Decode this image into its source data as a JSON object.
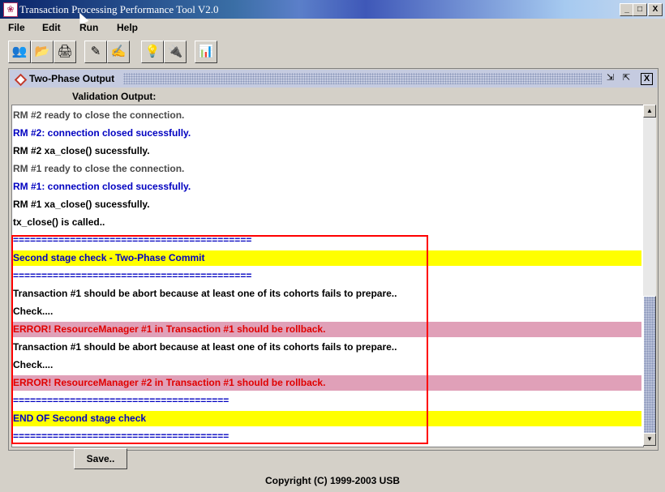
{
  "window": {
    "title": "Transaction Processing Performance Tool V2.0",
    "app_icon": "app-icon",
    "buttons": [
      "_",
      "□",
      "X"
    ]
  },
  "menu": [
    {
      "label": "File"
    },
    {
      "label": "Edit"
    },
    {
      "label": "Run"
    },
    {
      "label": "Help"
    }
  ],
  "toolbar": {
    "icons": [
      "open-people-icon",
      "folder-icon",
      "printer-icon",
      "wand-icon",
      "pen-icon",
      "bulb-icon",
      "plug-icon",
      "chart-icon"
    ]
  },
  "frame": {
    "title": "Two-Phase Output",
    "buttons": [
      "⇲",
      "⇱",
      "X"
    ],
    "validation_label": "Validation Output:"
  },
  "output": [
    {
      "text": "RM #2 ready to close the connection.",
      "color": "gray"
    },
    {
      "text": "RM #2: connection closed sucessfully.",
      "color": "blue"
    },
    {
      "text": "RM #2 xa_close() sucessfully.",
      "color": "black"
    },
    {
      "text": "RM #1 ready to close the connection.",
      "color": "gray"
    },
    {
      "text": "RM #1: connection closed sucessfully.",
      "color": "blue"
    },
    {
      "text": "RM #1 xa_close() sucessfully.",
      "color": "black"
    },
    {
      "text": "tx_close() is called..",
      "color": "black"
    },
    {
      "text": "==========================================",
      "color": "blue"
    },
    {
      "text": " Second stage check - Two-Phase Commit",
      "color": "blue",
      "highlight": "yellow"
    },
    {
      "text": "==========================================",
      "color": "blue"
    },
    {
      "text": "Transaction #1 should be abort because at least one of its cohorts fails to prepare..",
      "color": "black"
    },
    {
      "text": "Check....",
      "color": "black"
    },
    {
      "text": "ERROR! ResourceManager #1 in Transaction #1 should be rollback.",
      "color": "red",
      "highlight": "pink"
    },
    {
      "text": "Transaction #1 should be abort because at least one of its cohorts fails to prepare..",
      "color": "black"
    },
    {
      "text": "Check....",
      "color": "black"
    },
    {
      "text": "ERROR! ResourceManager #2 in Transaction #1 should be rollback.",
      "color": "red",
      "highlight": "pink"
    },
    {
      "text": "======================================",
      "color": "blue"
    },
    {
      "text": " END OF Second stage check",
      "color": "blue",
      "highlight": "yellow"
    },
    {
      "text": "======================================",
      "color": "blue"
    }
  ],
  "save_label": "Save..",
  "copyright": "Copyright (C) 1999-2003 USB",
  "colors": {
    "yellow": "#ffff00",
    "pink": "#e0a0b8",
    "blue": "#0000c0",
    "red": "#e00000",
    "gray": "#4a4a4a"
  }
}
